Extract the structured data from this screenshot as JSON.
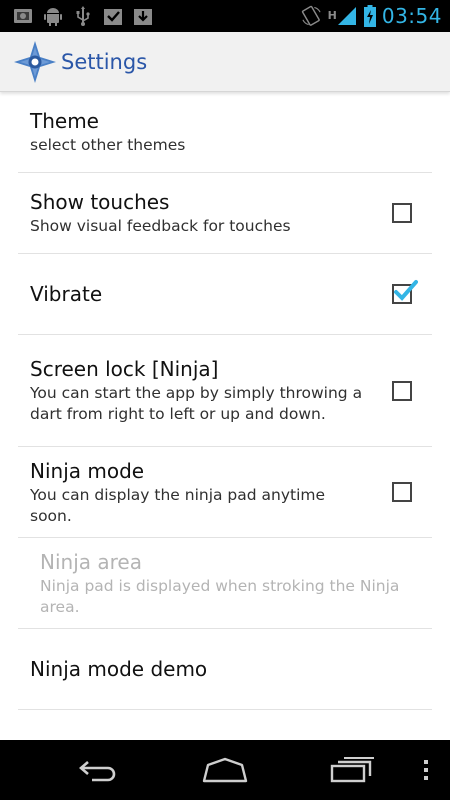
{
  "status_bar": {
    "time": "03:54",
    "network_label": "H",
    "left_icons": [
      "notification-icon",
      "android-debug-icon",
      "usb-icon",
      "download-done-icon",
      "download-icon"
    ],
    "right_icons": [
      "rotation-icon",
      "signal-icon",
      "battery-icon"
    ]
  },
  "action_bar": {
    "title": "Settings",
    "icon": "ninja-shuriken-icon",
    "title_color": "#2a56a8"
  },
  "preferences": [
    {
      "title": "Theme",
      "summary": "select other themes",
      "has_checkbox": false,
      "checked": false,
      "enabled": true
    },
    {
      "title": "Show touches",
      "summary": "Show visual feedback for touches",
      "has_checkbox": true,
      "checked": false,
      "enabled": true
    },
    {
      "title": "Vibrate",
      "summary": "",
      "has_checkbox": true,
      "checked": true,
      "enabled": true
    },
    {
      "title": "Screen lock [Ninja]",
      "summary": "You can start the app by simply throwing a dart from right to left or up and down.",
      "has_checkbox": true,
      "checked": false,
      "enabled": true
    },
    {
      "title": "Ninja mode",
      "summary": "You can display the ninja pad anytime soon.",
      "has_checkbox": true,
      "checked": false,
      "enabled": true
    },
    {
      "title": "Ninja area",
      "summary": "Ninja pad is displayed when stroking the Ninja area.",
      "has_checkbox": false,
      "checked": false,
      "enabled": false
    },
    {
      "title": "Ninja mode demo",
      "summary": "",
      "has_checkbox": false,
      "checked": false,
      "enabled": true
    }
  ],
  "nav_bar": {
    "buttons": [
      "back-icon",
      "home-icon",
      "recent-apps-icon",
      "menu-icon"
    ]
  },
  "colors": {
    "accent": "#33b5e5",
    "check": "#33b5e5"
  }
}
